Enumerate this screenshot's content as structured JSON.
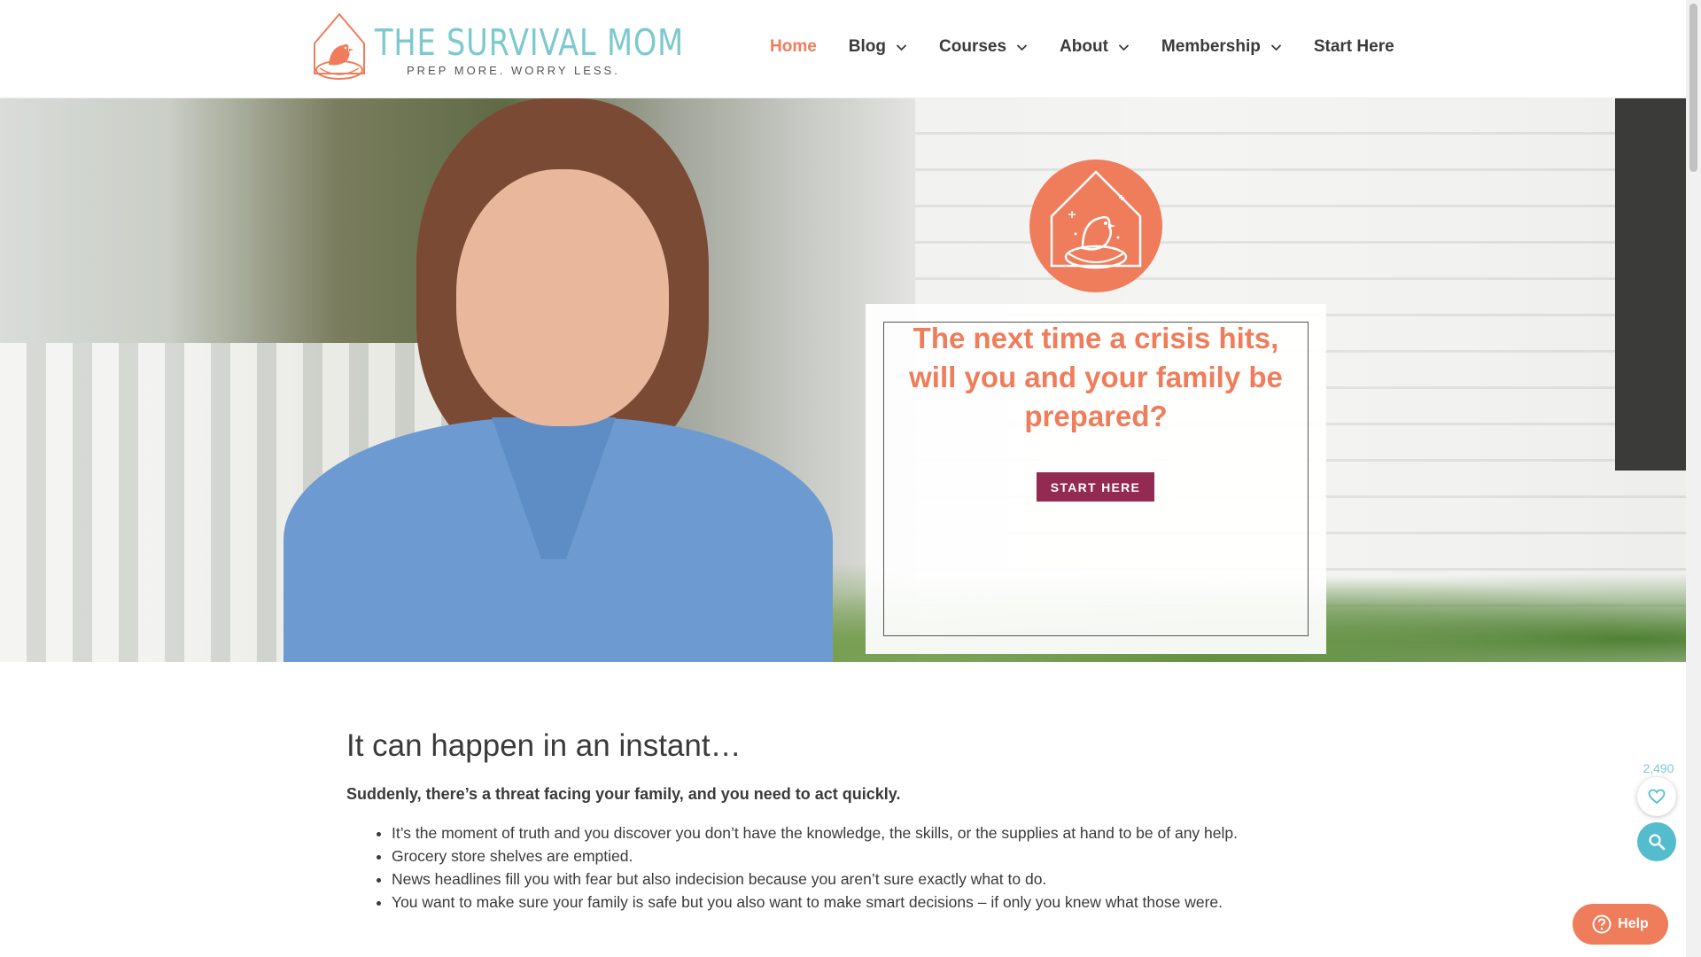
{
  "logo": {
    "title": "THE SURVIVAL MOM",
    "tagline": "PREP MORE. WORRY LESS.",
    "icon": "bird-in-nest-icon"
  },
  "nav": {
    "items": [
      {
        "label": "Home",
        "active": true,
        "has_dropdown": false
      },
      {
        "label": "Blog",
        "active": false,
        "has_dropdown": true
      },
      {
        "label": "Courses",
        "active": false,
        "has_dropdown": true
      },
      {
        "label": "About",
        "active": false,
        "has_dropdown": true
      },
      {
        "label": "Membership",
        "active": false,
        "has_dropdown": true
      },
      {
        "label": "Start Here",
        "active": false,
        "has_dropdown": false
      }
    ]
  },
  "hero": {
    "badge_icon": "birdhouse-icon",
    "headline": "The next time a crisis hits, will you and your family be prepared?",
    "button_label": "START HERE"
  },
  "content": {
    "heading": "It can happen in an instant…",
    "lead": "Suddenly, there’s a threat facing your family, and you need to act quickly.",
    "bullets": [
      "It’s the moment of truth and you discover you don’t have the knowledge, the skills, or the supplies at hand to be of any help.",
      "Grocery store shelves are emptied.",
      "News headlines fill you with fear but also indecision because you aren’t sure exactly what to do.",
      "You want to make sure your family is safe but you also want to make smart decisions – if only you knew what those were."
    ]
  },
  "widgets": {
    "like_count": "2,490",
    "like_icon": "heart-icon",
    "search_icon": "search-icon",
    "help_label": "Help",
    "help_icon": "question-mark-icon"
  },
  "colors": {
    "accent": "#ef7d5b",
    "logo_teal": "#7cc9cf",
    "button": "#922a52",
    "search_button": "#55bccd"
  }
}
